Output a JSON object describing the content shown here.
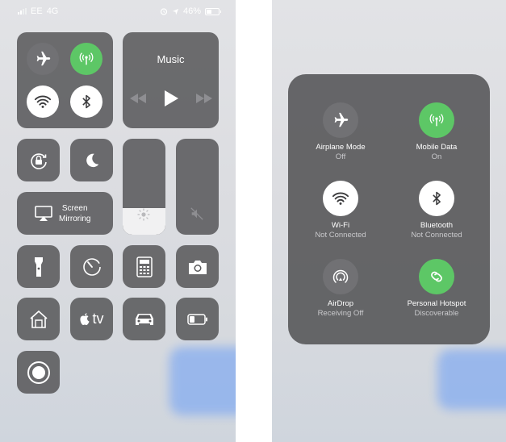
{
  "status": {
    "carrier": "EE",
    "network": "4G",
    "battery": "46%"
  },
  "music": {
    "title": "Music"
  },
  "screen_mirroring": {
    "line1": "Screen",
    "line2": "Mirroring"
  },
  "tv_label": "tv",
  "expanded": {
    "items": [
      {
        "label": "Airplane Mode",
        "status": "Off"
      },
      {
        "label": "Mobile Data",
        "status": "On"
      },
      {
        "label": "Wi-Fi",
        "status": "Not Connected"
      },
      {
        "label": "Bluetooth",
        "status": "Not Connected"
      },
      {
        "label": "AirDrop",
        "status": "Receiving Off"
      },
      {
        "label": "Personal Hotspot",
        "status": "Discoverable"
      }
    ]
  },
  "levels": {
    "brightness": 0.28,
    "battery": 0.46
  },
  "colors": {
    "green": "#5dc766",
    "tile": "#5a5a5c",
    "active_white": "#ffffff"
  }
}
